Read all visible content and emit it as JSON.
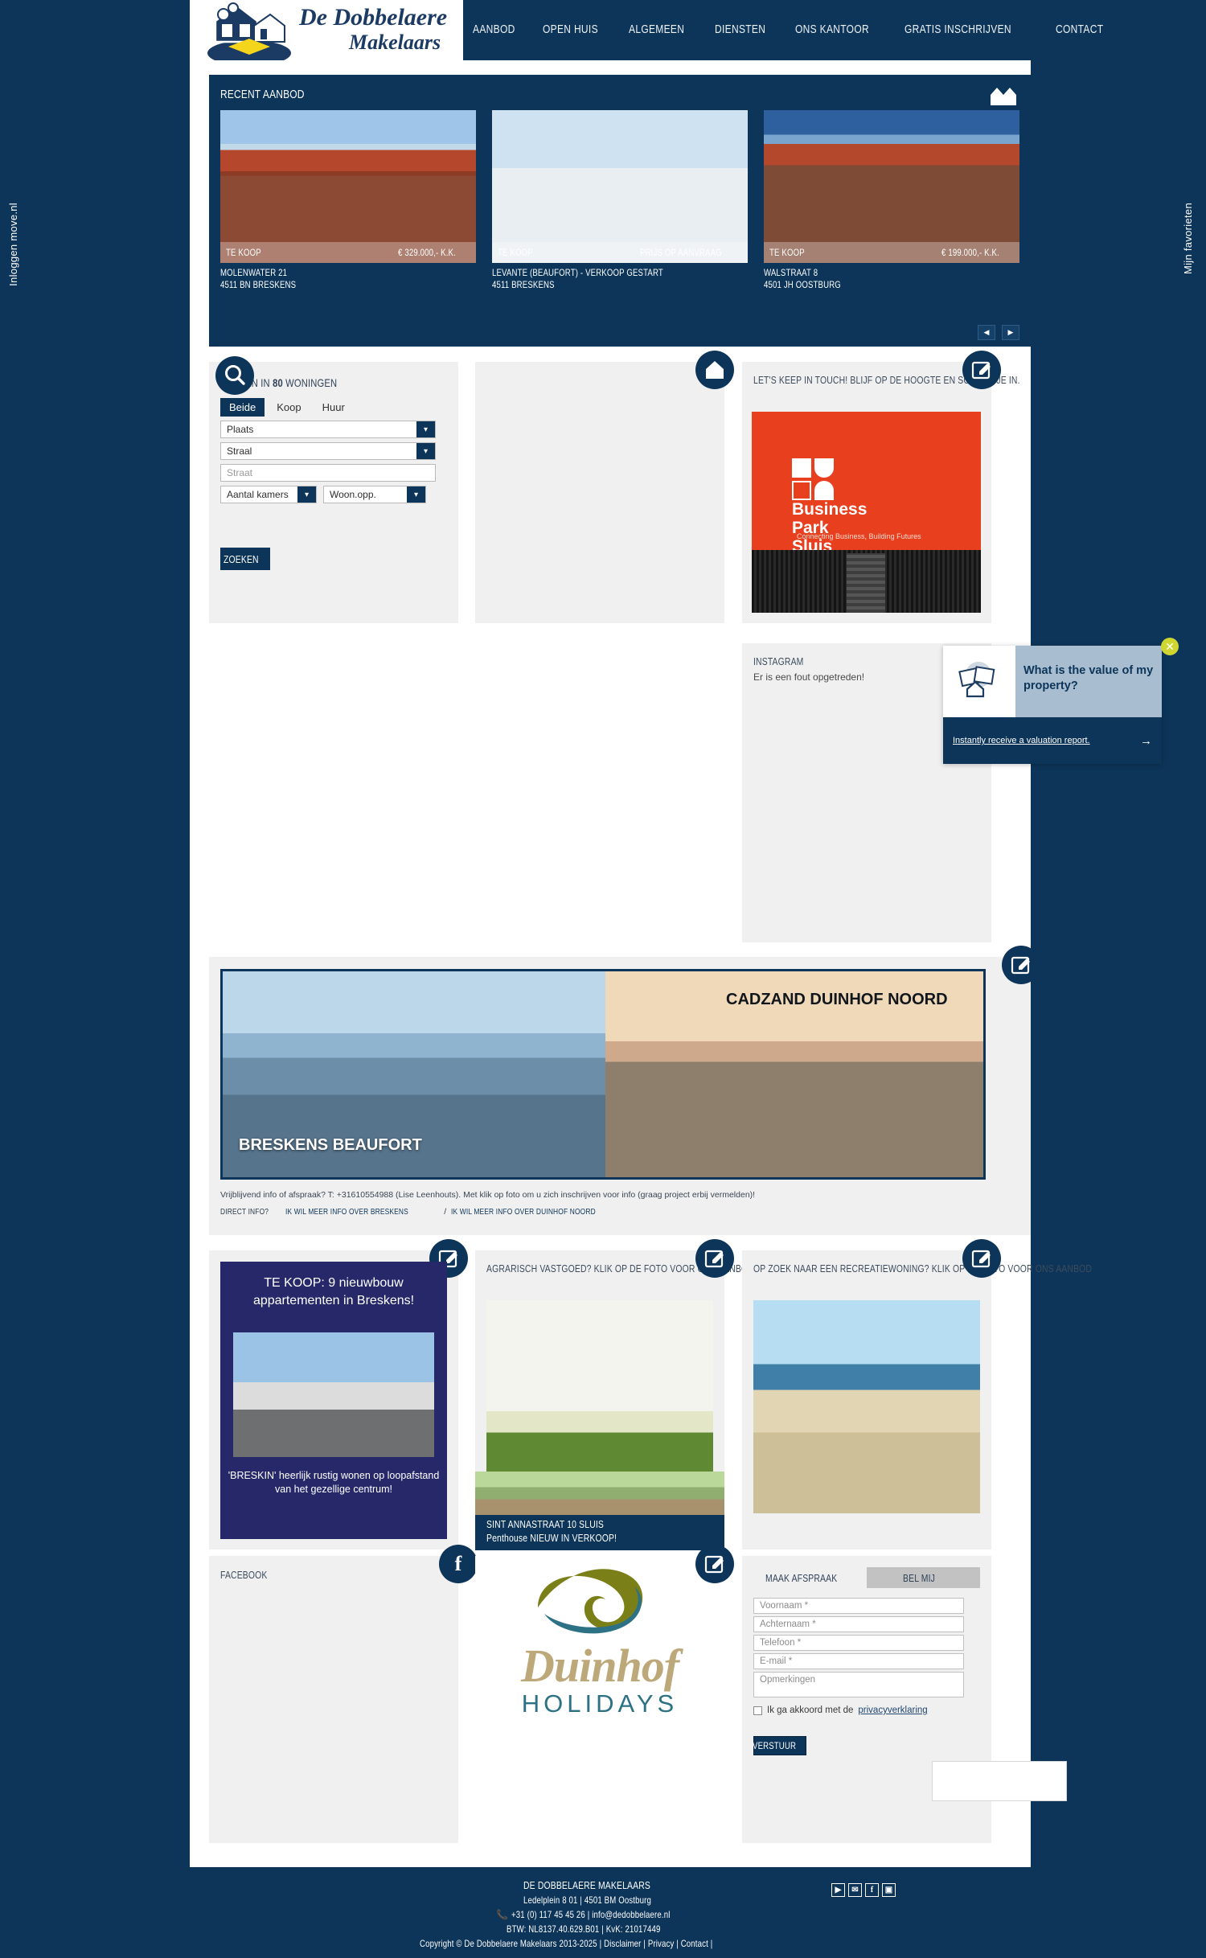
{
  "sidebar": {
    "left_label": "Inloggen move.nl",
    "right_label": "Mijn favorieten"
  },
  "header": {
    "logo_line1": "De Dobbelaere",
    "logo_line2": "Makelaars",
    "nav": [
      {
        "label": "AANBOD"
      },
      {
        "label": "OPEN HUIS"
      },
      {
        "label": "ALGEMEEN"
      },
      {
        "label": "DIENSTEN"
      },
      {
        "label": "ONS KANTOOR"
      },
      {
        "label": "GRATIS INSCHRIJVEN"
      },
      {
        "label": "CONTACT"
      }
    ]
  },
  "recent": {
    "title": "RECENT AANBOD",
    "prev_label": "◀",
    "next_label": "▶",
    "listings": [
      {
        "status": "TE KOOP",
        "price": "€ 329.000,- K.K.",
        "street": "MOLENWATER 21",
        "city": "4511 BN BRESKENS"
      },
      {
        "status": "TE KOOP",
        "price": "PRIJS OP AANVRAAG",
        "street": "LEVANTE (BEAUFORT) - VERKOOP GESTART",
        "city": "4511 BRESKENS"
      },
      {
        "status": "TE KOOP",
        "price": "€ 199.000,- K.K.",
        "street": "WALSTRAAT 8",
        "city": "4501 JH OOSTBURG"
      }
    ]
  },
  "search": {
    "heading_pre": "ZOEKEN IN ",
    "heading_count": "80",
    "heading_post": " WONINGEN",
    "tabs": [
      {
        "label": "Beide",
        "active": true
      },
      {
        "label": "Koop",
        "active": false
      },
      {
        "label": "Huur",
        "active": false
      }
    ],
    "plaats": "Plaats",
    "straal": "Straal",
    "straat_placeholder": "Straat",
    "kamers": "Aantal kamers",
    "woonopp": "Woon.opp.",
    "submit": "ZOEKEN"
  },
  "newsletter": {
    "title": "LET'S KEEP IN TOUCH! BLIJF OP DE HOOGTE EN SCHRIJF JE IN.",
    "banner_line1": "Business",
    "banner_line2": "Park",
    "banner_line3": "Sluis",
    "banner_tagline": "Connecting Business, Building Futures"
  },
  "instagram": {
    "title": "INSTAGRAM",
    "error": "Er is een fout opgetreden!"
  },
  "popup": {
    "question": "What is the value of my property?",
    "link": "Instantly receive a valuation report.",
    "arrow": "→",
    "close": "✕",
    "close_color": "#cfd630"
  },
  "banner": {
    "left_label": "BRESKENS BEAUFORT",
    "right_label": "CADZAND DUINHOF NOORD",
    "note": "Vrijblijvend info of afspraak? T: +31610554988 (Lise Leenhouts). Met klik op foto om u zich inschrijven voor info (graag project erbij vermelden)!",
    "direct_prefix": "DIRECT INFO?",
    "link1": "IK WIL MEER INFO OVER BRESKENS",
    "separator": "/",
    "link2": "IK WIL MEER INFO OVER DUINHOF NOORD"
  },
  "promos": [
    {
      "headline": "TE KOOP:  9 nieuwbouw appartementen in Breskens!",
      "footer": "'BRESKIN' heerlijk rustig wonen op loopafstand van het gezellige centrum!"
    },
    {
      "title": "AGRARISCH VASTGOED? KLIK OP DE FOTO VOOR ONS AANBOD"
    },
    {
      "title": "OP ZOEK NAAR EEN RECREATIEWONING? KLIK OP DE FOTO VOOR ONS AANBOD"
    }
  ],
  "sint_anna": {
    "line1": "SINT ANNASTRAAT 10  SLUIS",
    "line2": "Penthouse NIEUW IN VERKOOP!"
  },
  "facebook": {
    "title": "FACEBOOK",
    "icon_letter": "f"
  },
  "duinhof": {
    "word": "Duinhof",
    "sub": "HOLIDAYS"
  },
  "contact_form": {
    "tab_active": "MAAK AFSPRAAK",
    "tab_idle": "BEL MIJ",
    "fields": [
      {
        "placeholder": "Voornaam *"
      },
      {
        "placeholder": "Achternaam *"
      },
      {
        "placeholder": "Telefoon *"
      },
      {
        "placeholder": "E-mail *"
      }
    ],
    "textarea_placeholder": "Opmerkingen",
    "consent_text": "Ik ga akkoord met de ",
    "consent_link": "privacyverklaring",
    "submit": "VERSTUUR"
  },
  "footer": {
    "company": "DE DOBBELAERE MAKELAARS",
    "address": "Ledelplein 8 01 | 4501 BM Oostburg",
    "phone_line": "+31 (0) 117 45 45 26 | info@dedobbelaere.nl",
    "tax_line": "BTW: NL8137.40.629.B01 | KvK: 21017449",
    "copyright": "Copyright © De Dobbelaere Makelaars 2013-2025 |  Disclaimer | Privacy | Contact |",
    "social": [
      {
        "glyph": "▶",
        "name": "youtube"
      },
      {
        "glyph": "✉",
        "name": "twitter"
      },
      {
        "glyph": "f",
        "name": "facebook"
      },
      {
        "glyph": "▣",
        "name": "instagram"
      }
    ]
  },
  "colors": {
    "brand_navy": "#0d3559",
    "accent_orange": "#e8401f",
    "promo_purple": "#26286a"
  }
}
